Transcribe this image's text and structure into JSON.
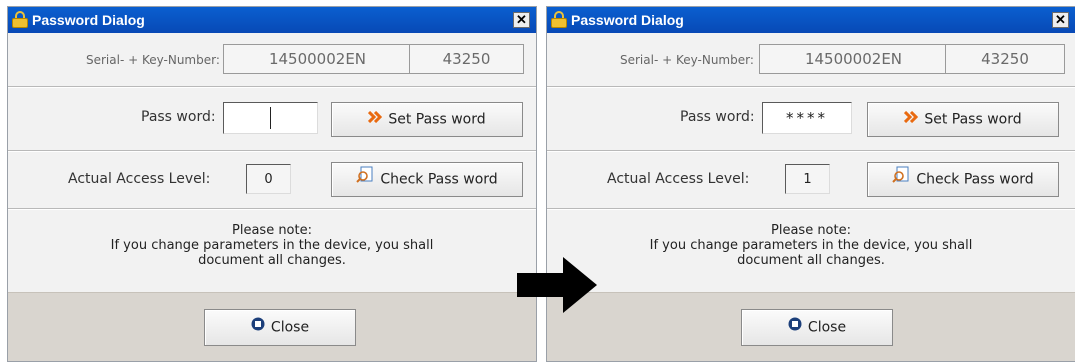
{
  "dialogs": [
    {
      "title": "Password Dialog",
      "close_glyph": "✕",
      "serial_label": "Serial- + Key-Number:",
      "serial_value": "14500002EN",
      "key_value": "43250",
      "password_label": "Pass word:",
      "password_value": "",
      "set_password_label": "Set Pass word",
      "access_label": "Actual Access Level:",
      "access_value": "0",
      "check_password_label": "Check Pass word",
      "note_title": "Please note:",
      "note_line1": "If you change parameters in  the device, you shall",
      "note_line2": "document all changes.",
      "close_button_label": "Close"
    },
    {
      "title": "Password Dialog",
      "close_glyph": "✕",
      "serial_label": "Serial- + Key-Number:",
      "serial_value": "14500002EN",
      "key_value": "43250",
      "password_label": "Pass word:",
      "password_value": "****",
      "set_password_label": "Set Pass word",
      "access_label": "Actual Access Level:",
      "access_value": "1",
      "check_password_label": "Check Pass word",
      "note_title": "Please note:",
      "note_line1": "If you change parameters in  the device, you shall",
      "note_line2": "document all changes.",
      "close_button_label": "Close"
    }
  ],
  "icons": {
    "lock": "lock-icon",
    "set_password": "double-chevron-right-icon",
    "check_password": "magnifier-document-icon",
    "close_button": "stop-square-icon",
    "transition": "arrow-right-icon"
  },
  "colors": {
    "titlebar": "#0849b6",
    "dialog_bg": "#f2f2f2",
    "footer_bg": "#d9d5cf",
    "chevron_orange": "#e96a10"
  }
}
